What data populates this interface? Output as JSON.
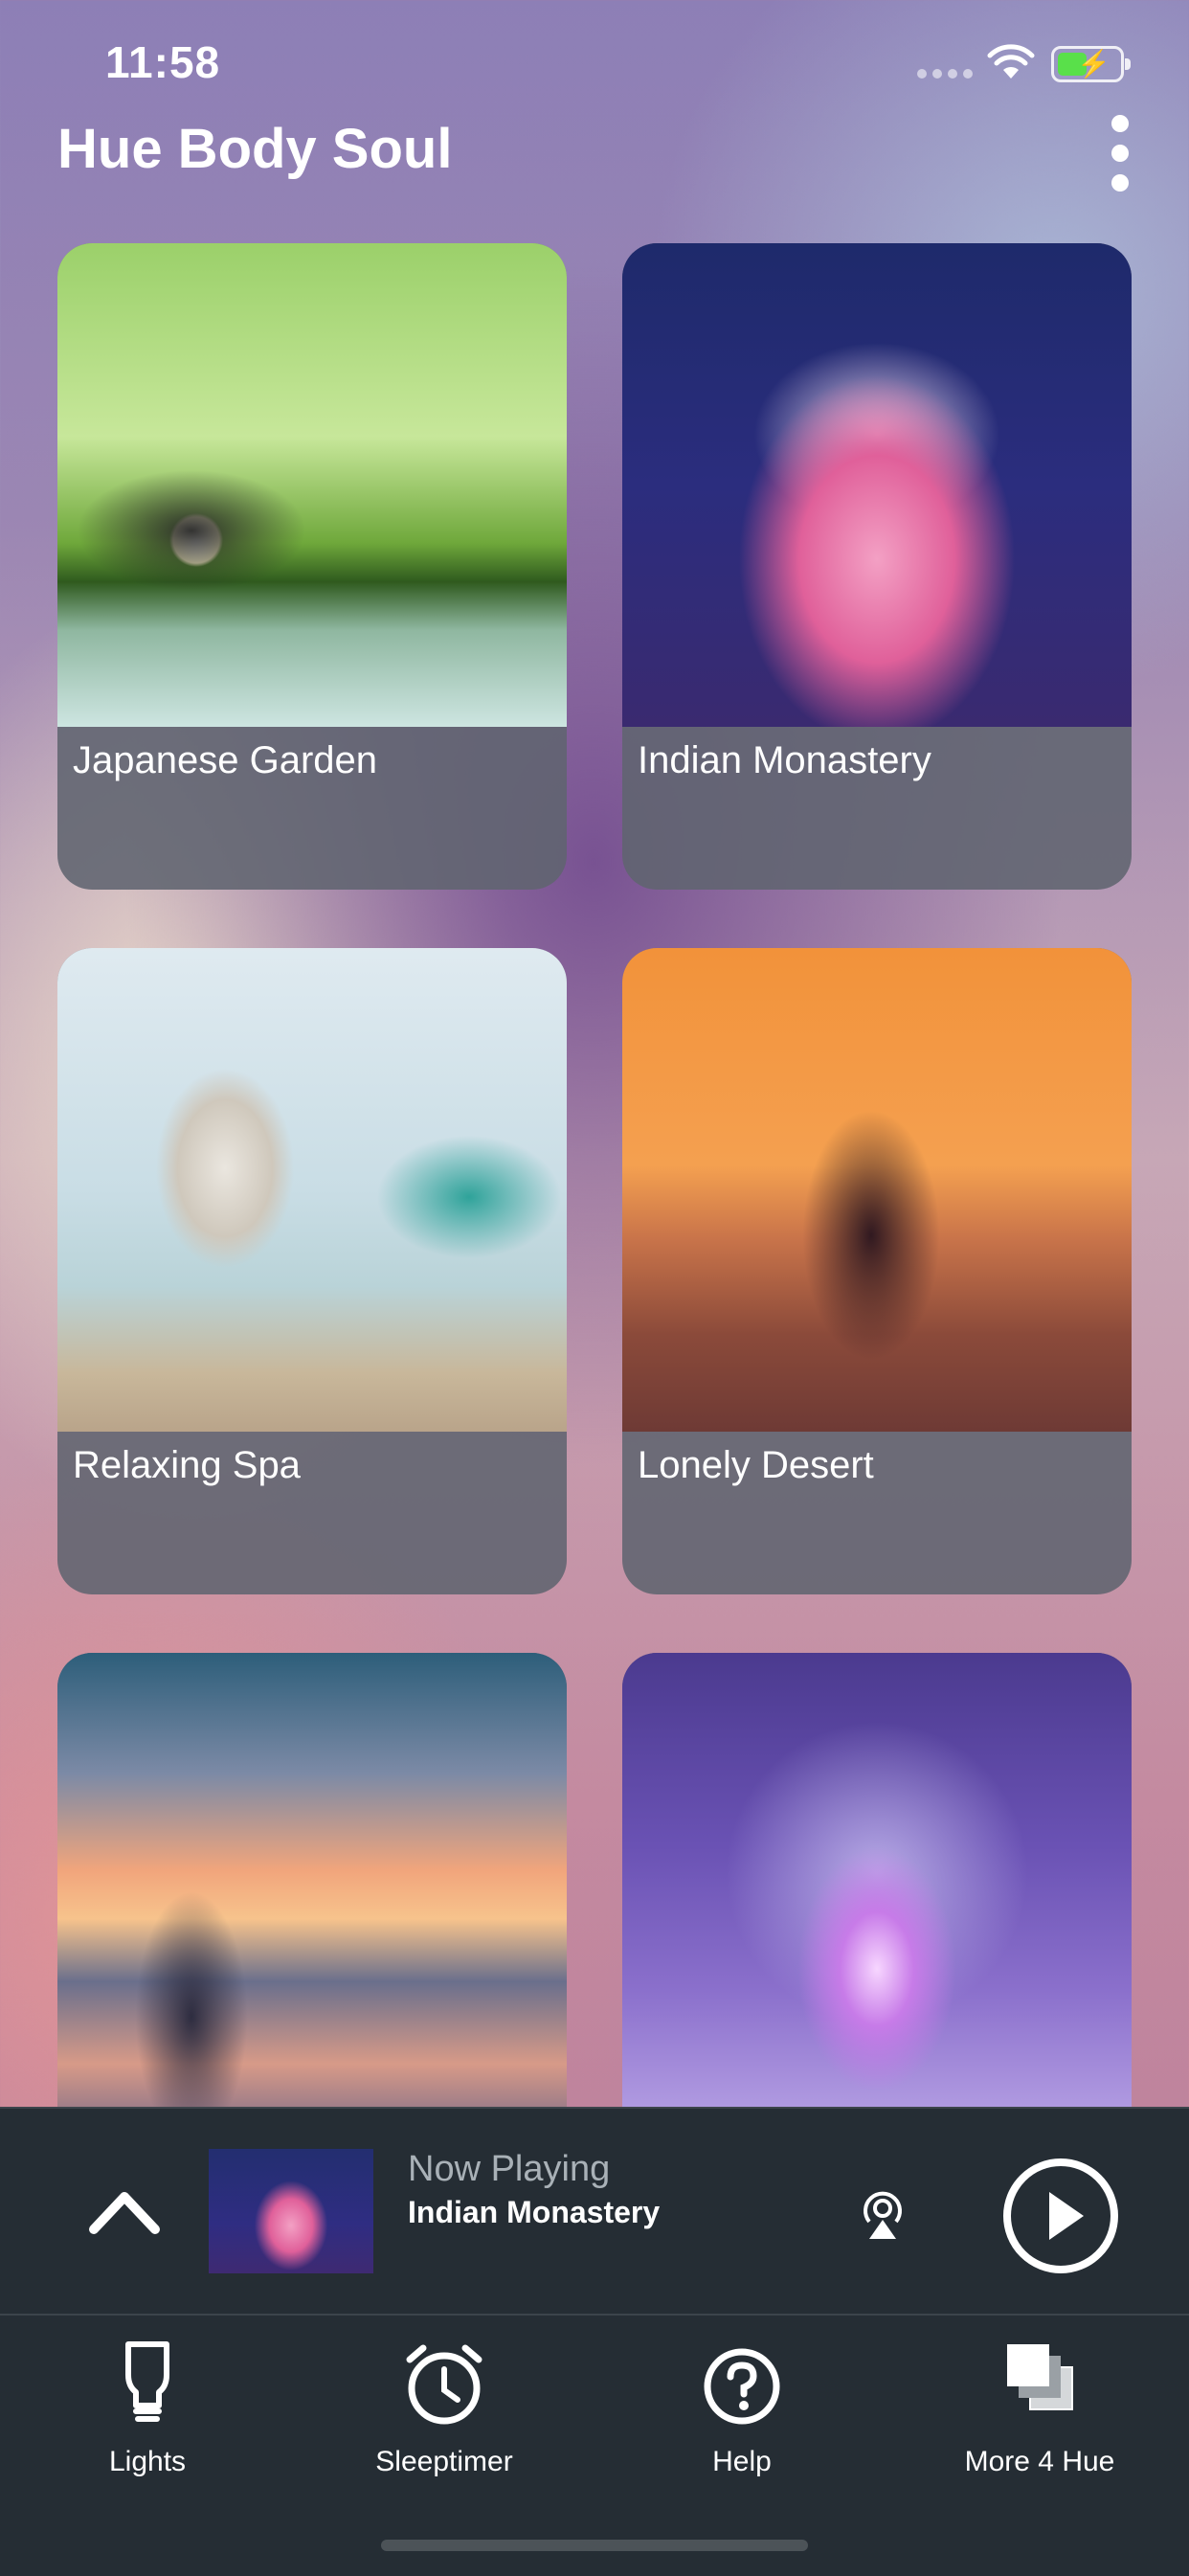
{
  "status_bar": {
    "time": "11:58"
  },
  "header": {
    "title": "Hue Body Soul"
  },
  "scenes": [
    {
      "label": "Japanese Garden"
    },
    {
      "label": "Indian Monastery"
    },
    {
      "label": "Relaxing Spa"
    },
    {
      "label": "Lonely Desert"
    },
    {
      "label": ""
    },
    {
      "label": ""
    }
  ],
  "now_playing": {
    "label": "Now Playing",
    "title": "Indian Monastery"
  },
  "tabs": [
    {
      "label": "Lights",
      "icon": "lightbulb-icon"
    },
    {
      "label": "Sleeptimer",
      "icon": "alarm-clock-icon"
    },
    {
      "label": "Help",
      "icon": "help-icon"
    },
    {
      "label": "More 4 Hue",
      "icon": "layers-icon"
    }
  ],
  "colors": {
    "bar_background": "#252d34",
    "battery_fill": "#59e04a"
  }
}
